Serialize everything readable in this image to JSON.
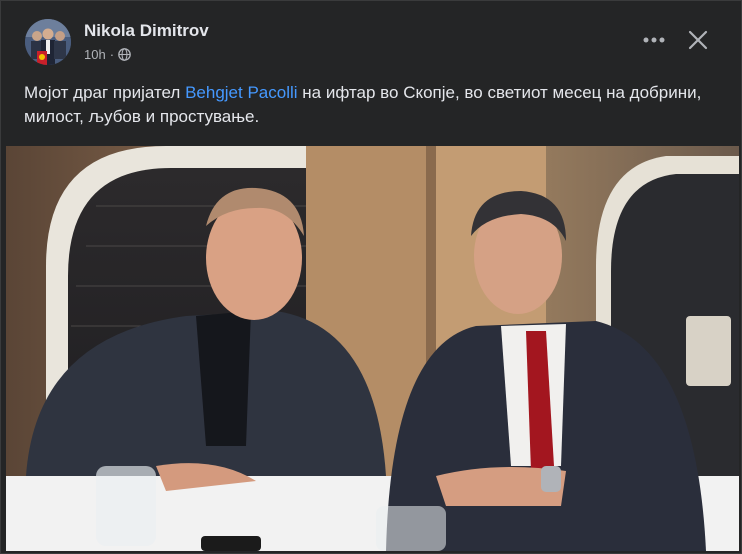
{
  "post": {
    "author": "Nikola Dimitrov",
    "time": "10h",
    "dot": "·",
    "caption_before": "Мојот драг пријател ",
    "mention": "Behgjet Pacolli",
    "caption_after": " на ифтар во Скопје, во светиот месец на добрини, милост, љубов и простување."
  },
  "icons": {
    "audience": "globe-icon",
    "menu": "more-horizontal-icon",
    "close": "close-icon"
  },
  "colors": {
    "background": "#242526",
    "text": "#e4e6eb",
    "secondary_text": "#b0b3b8",
    "link": "#4599ff"
  }
}
